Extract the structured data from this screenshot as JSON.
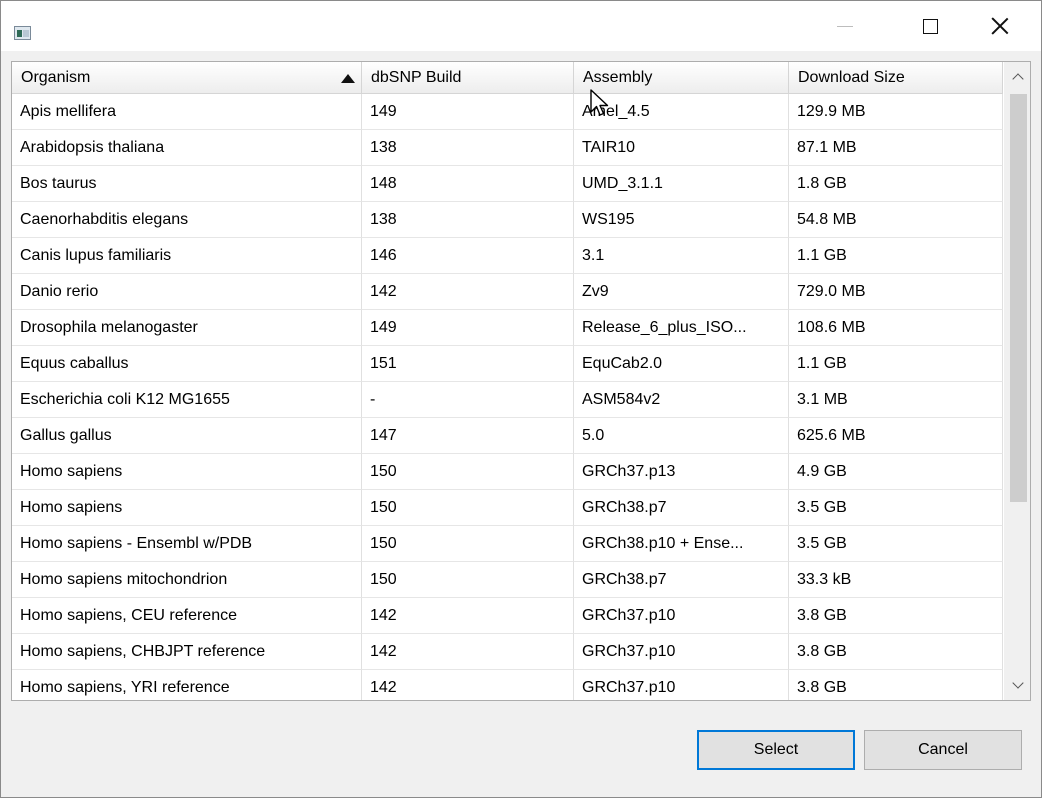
{
  "window": {
    "title": "",
    "controls": {
      "minimize": "minimize-icon",
      "maximize": "maximize-icon",
      "close": "close-icon"
    }
  },
  "table": {
    "columns": [
      "Organism",
      "dbSNP Build",
      "Assembly",
      "Download Size"
    ],
    "sorted_column": "Organism",
    "sort_direction": "ascending",
    "rows": [
      [
        "Apis mellifera",
        "149",
        "Amel_4.5",
        "129.9 MB"
      ],
      [
        "Arabidopsis thaliana",
        "138",
        "TAIR10",
        "87.1 MB"
      ],
      [
        "Bos taurus",
        "148",
        "UMD_3.1.1",
        "1.8 GB"
      ],
      [
        "Caenorhabditis elegans",
        "138",
        "WS195",
        "54.8 MB"
      ],
      [
        "Canis lupus familiaris",
        "146",
        "3.1",
        "1.1 GB"
      ],
      [
        "Danio rerio",
        "142",
        "Zv9",
        "729.0 MB"
      ],
      [
        "Drosophila melanogaster",
        "149",
        "Release_6_plus_ISO...",
        "108.6 MB"
      ],
      [
        "Equus caballus",
        "151",
        "EquCab2.0",
        "1.1 GB"
      ],
      [
        "Escherichia coli K12 MG1655",
        "-",
        "ASM584v2",
        "3.1 MB"
      ],
      [
        "Gallus gallus",
        "147",
        "5.0",
        "625.6 MB"
      ],
      [
        "Homo sapiens",
        "150",
        "GRCh37.p13",
        "4.9 GB"
      ],
      [
        "Homo sapiens",
        "150",
        "GRCh38.p7",
        "3.5 GB"
      ],
      [
        "Homo sapiens - Ensembl w/PDB",
        "150",
        "GRCh38.p10 + Ense...",
        "3.5 GB"
      ],
      [
        "Homo sapiens mitochondrion",
        "150",
        "GRCh38.p7",
        "33.3 kB"
      ],
      [
        "Homo sapiens, CEU reference",
        "142",
        "GRCh37.p10",
        "3.8 GB"
      ],
      [
        "Homo sapiens, CHBJPT reference",
        "142",
        "GRCh37.p10",
        "3.8 GB"
      ],
      [
        "Homo sapiens, YRI reference",
        "142",
        "GRCh37.p10",
        "3.8 GB"
      ],
      [
        "",
        "",
        "",
        ""
      ]
    ]
  },
  "buttons": {
    "select_label": "Select",
    "cancel_label": "Cancel"
  },
  "colors": {
    "accent": "#0078d7",
    "scroll_thumb": "#cdcdcd",
    "window_bg": "#f0f0f0"
  }
}
